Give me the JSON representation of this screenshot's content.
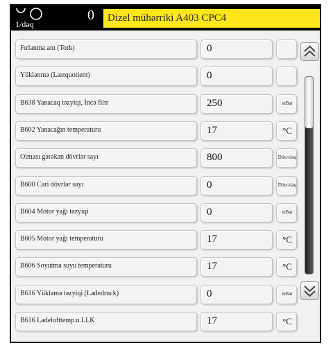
{
  "header": {
    "rpm_unit": "1/dəq",
    "rpm_value": "0",
    "title": "Dizel mühərriki A403 CPC4"
  },
  "rows": [
    {
      "label": "Fırlanma anı (Tork)",
      "value": "0",
      "unit": ""
    },
    {
      "label": "Yüklənmə (Lastquotient)",
      "value": "0",
      "unit": ""
    },
    {
      "label": "B638 Yanacaq təzyiqi, İncə filtr",
      "value": "250",
      "unit": "mBar"
    },
    {
      "label": "B602 Yanacağın temperaturu",
      "value": "17",
      "unit": "°C"
    },
    {
      "label": "Olması gərəkən dövrlər sayı",
      "value": "800",
      "unit": "Dövr/dəq"
    },
    {
      "label": "B600 Cari dövrlər sayı",
      "value": "0",
      "unit": "Dövr/dəq"
    },
    {
      "label": "B604 Motor yağı təzyiqi",
      "value": "0",
      "unit": "mBar"
    },
    {
      "label": "B605 Motor yağı temperaturu",
      "value": "17",
      "unit": "°C"
    },
    {
      "label": "B606 Soyutma suyu temperaturu",
      "value": "17",
      "unit": "°C"
    },
    {
      "label": "B616 Yükləmə təzyiqi (Ladedruck)",
      "value": "0",
      "unit": "mBar"
    },
    {
      "label": "B616 Ladelufttemp.n.LLK",
      "value": "17",
      "unit": "°C"
    }
  ],
  "icons": {
    "rpm": "engine-rpm-icon",
    "scroll_up": "double-chevron-up-icon",
    "scroll_down": "double-chevron-down-icon"
  },
  "colors": {
    "header_background": "#000000",
    "title_background": "#ffe61a"
  },
  "scroll": {
    "position_fraction": 0.0
  }
}
